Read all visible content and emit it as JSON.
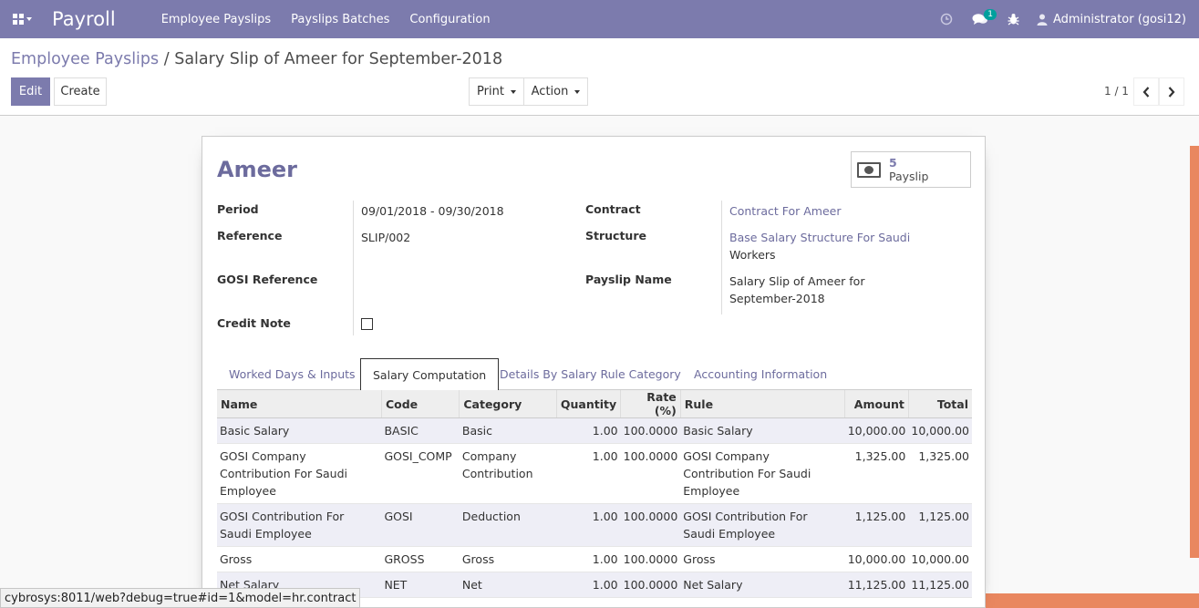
{
  "navbar": {
    "app_title": "Payroll",
    "menu": [
      "Employee Payslips",
      "Payslips Batches",
      "Configuration"
    ],
    "messages_count": "1",
    "user": "Administrator (gosi12)"
  },
  "breadcrumb": {
    "parent": "Employee Payslips",
    "separator": "/",
    "current": "Salary Slip of Ameer for September-2018"
  },
  "buttons": {
    "edit": "Edit",
    "create": "Create",
    "print": "Print",
    "action": "Action"
  },
  "pager": {
    "value": "1 / 1"
  },
  "form": {
    "employee": "Ameer",
    "payslip_stat": {
      "count": "5",
      "label": "Payslip"
    },
    "fields": {
      "period_label": "Period",
      "period_value": "09/01/2018 - 09/30/2018",
      "reference_label": "Reference",
      "reference_value": "SLIP/002",
      "gosi_reference_label": "GOSI Reference",
      "gosi_reference_value": "",
      "credit_note_label": "Credit Note",
      "contract_label": "Contract",
      "contract_value": "Contract For Ameer",
      "structure_label": "Structure",
      "structure_value_line1": "Base Salary Structure For Saudi",
      "structure_value_line2": "Workers",
      "payslip_name_label": "Payslip Name",
      "payslip_name_line1": "Salary Slip of Ameer for",
      "payslip_name_line2": "September-2018"
    },
    "tabs": [
      "Worked Days & Inputs",
      "Salary Computation",
      "Details By Salary Rule Category",
      "Accounting Information"
    ],
    "active_tab": "Salary Computation",
    "table": {
      "headers": [
        "Name",
        "Code",
        "Category",
        "Quantity",
        "Rate (%)",
        "Rule",
        "Amount",
        "Total"
      ],
      "rows": [
        [
          "Basic Salary",
          "BASIC",
          "Basic",
          "1.00",
          "100.0000",
          "Basic Salary",
          "10,000.00",
          "10,000.00"
        ],
        [
          "GOSI Company Contribution For Saudi Employee",
          "GOSI_COMP",
          "Company Contribution",
          "1.00",
          "100.0000",
          "GOSI Company Contribution For Saudi Employee",
          "1,325.00",
          "1,325.00"
        ],
        [
          "GOSI Contribution For Saudi Employee",
          "GOSI",
          "Deduction",
          "1.00",
          "100.0000",
          "GOSI Contribution For Saudi Employee",
          "1,125.00",
          "1,125.00"
        ],
        [
          "Gross",
          "GROSS",
          "Gross",
          "1.00",
          "100.0000",
          "Gross",
          "10,000.00",
          "10,000.00"
        ],
        [
          "Net Salary",
          "NET",
          "Net",
          "1.00",
          "100.0000",
          "Net Salary",
          "11,125.00",
          "11,125.00"
        ]
      ]
    }
  },
  "status_bar": {
    "url": "cybrosys:8011/web?debug=true#id=1&model=hr.contract"
  },
  "colors": {
    "brand": "#7c7bad",
    "accent": "#e9875f",
    "link": "#6c6b9d"
  }
}
